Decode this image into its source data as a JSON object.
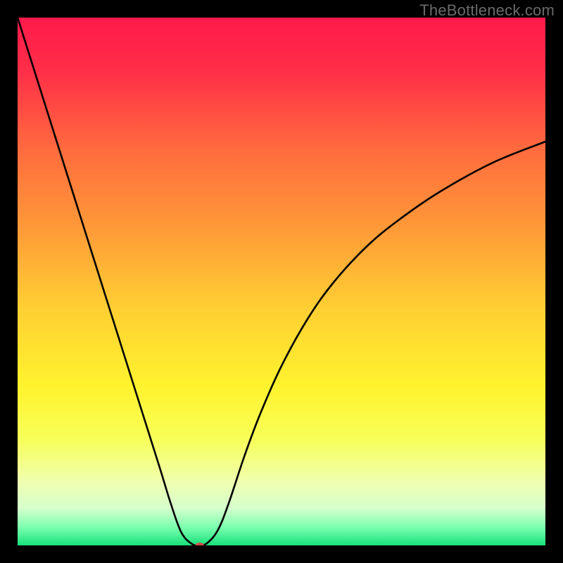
{
  "watermark": "TheBottleneck.com",
  "chart_data": {
    "type": "line",
    "title": "",
    "xlabel": "",
    "ylabel": "",
    "xlim": [
      0,
      100
    ],
    "ylim": [
      0,
      100
    ],
    "background_gradient": {
      "stops": [
        {
          "offset": 0.0,
          "color": "#ff1a4b"
        },
        {
          "offset": 0.1,
          "color": "#ff2e48"
        },
        {
          "offset": 0.25,
          "color": "#ff6b3e"
        },
        {
          "offset": 0.4,
          "color": "#ff9a38"
        },
        {
          "offset": 0.55,
          "color": "#ffcf33"
        },
        {
          "offset": 0.7,
          "color": "#fff32e"
        },
        {
          "offset": 0.8,
          "color": "#f7ff5a"
        },
        {
          "offset": 0.88,
          "color": "#f0ffb0"
        },
        {
          "offset": 0.93,
          "color": "#d5ffcc"
        },
        {
          "offset": 0.965,
          "color": "#7dffb0"
        },
        {
          "offset": 1.0,
          "color": "#18e07a"
        }
      ]
    },
    "series": [
      {
        "name": "bottleneck-curve",
        "x": [
          0,
          3,
          6,
          9,
          12,
          15,
          18,
          21,
          24,
          27,
          29,
          31,
          33,
          34.5,
          36,
          38,
          40,
          43,
          46,
          50,
          55,
          60,
          66,
          72,
          80,
          90,
          100
        ],
        "y": [
          100,
          90.5,
          81,
          71.5,
          62,
          52.5,
          43,
          33.5,
          24,
          14.5,
          8,
          2.5,
          0.3,
          0,
          0.5,
          3,
          8,
          17,
          25,
          34,
          43,
          50,
          56.5,
          61.5,
          67,
          72.5,
          76.5
        ]
      }
    ],
    "marker": {
      "x": 34.5,
      "y": 0,
      "color": "#cc4f4a",
      "rx": 6,
      "ry": 4
    }
  }
}
